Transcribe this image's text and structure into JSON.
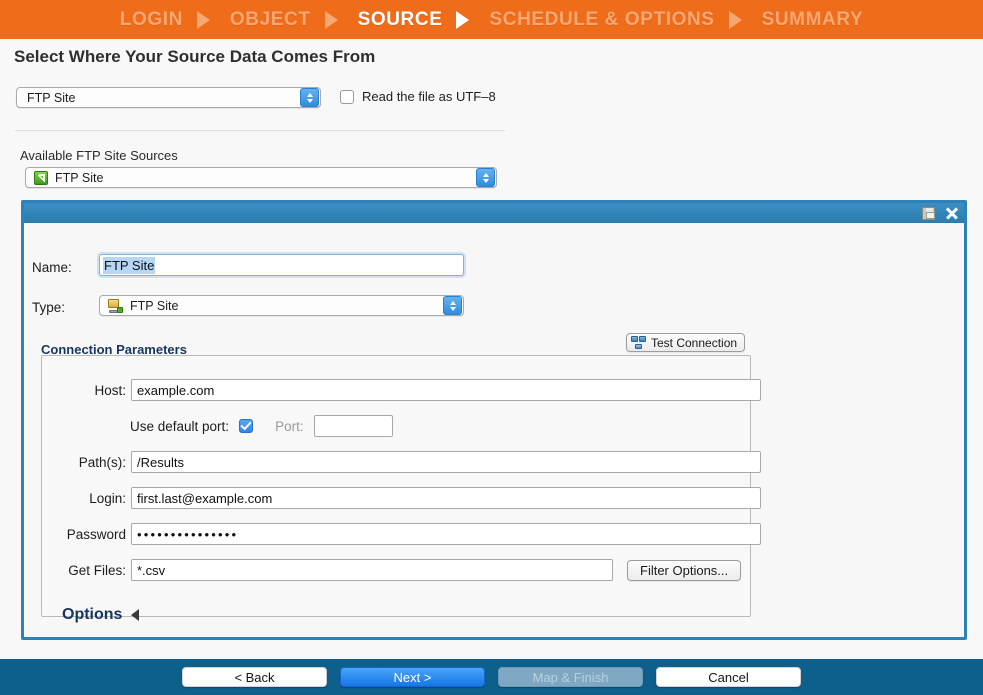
{
  "wizard": {
    "steps": [
      {
        "label": "LOGIN",
        "active": false
      },
      {
        "label": "OBJECT",
        "active": false
      },
      {
        "label": "SOURCE",
        "active": true
      },
      {
        "label": "SCHEDULE & OPTIONS",
        "active": false
      },
      {
        "label": "SUMMARY",
        "active": false
      }
    ],
    "active_step": "SOURCE",
    "bg_color": "#ef6c1a",
    "active_text_color": "#ffffff",
    "inactive_text_color": "#f7a773"
  },
  "page": {
    "title": "Select Where Your Source Data Comes From",
    "source_type_select": {
      "value": "FTP Site",
      "icon": "stepper-icon"
    },
    "utf8_checkbox": {
      "label": "Read the file as UTF–8",
      "checked": false
    },
    "available_sources": {
      "label": "Available FTP Site Sources",
      "value": "FTP Site",
      "icon": "ftp-site-green-icon"
    }
  },
  "dialog": {
    "titlebar": {
      "save_icon": "save-icon",
      "close_icon": "close-icon"
    },
    "name": {
      "label": "Name:",
      "value": "FTP Site",
      "selected": true
    },
    "type": {
      "label": "Type:",
      "value": "FTP Site",
      "icon": "server-icon"
    },
    "connection_parameters": {
      "title": "Connection Parameters",
      "title_color": "#17365d",
      "test_connection_button": {
        "label": "Test Connection",
        "icon": "network-icon"
      },
      "fields": {
        "host": {
          "label": "Host:",
          "value": "example.com"
        },
        "use_default_port": {
          "label": "Use default port:",
          "checked": true
        },
        "port": {
          "label": "Port:",
          "value": "",
          "disabled": true
        },
        "paths": {
          "label": "Path(s):",
          "value": "/Results"
        },
        "login": {
          "label": "Login:",
          "value": "first.last@example.com"
        },
        "password": {
          "label": "Password",
          "value": "•••••••••••••••"
        },
        "get_files": {
          "label": "Get Files:",
          "value": "*.csv"
        }
      },
      "filter_options_button": {
        "label": "Filter Options..."
      }
    },
    "options_section": {
      "label": "Options",
      "expanded": false,
      "caret": "caret-left-icon"
    }
  },
  "footer": {
    "bg_color": "#0d5f8c",
    "buttons": [
      {
        "label": "< Back",
        "style": "plain",
        "disabled": false
      },
      {
        "label": "Next >",
        "style": "primary",
        "disabled": false
      },
      {
        "label": "Map & Finish",
        "style": "disabled",
        "disabled": true
      },
      {
        "label": "Cancel",
        "style": "plain",
        "disabled": false
      }
    ]
  }
}
